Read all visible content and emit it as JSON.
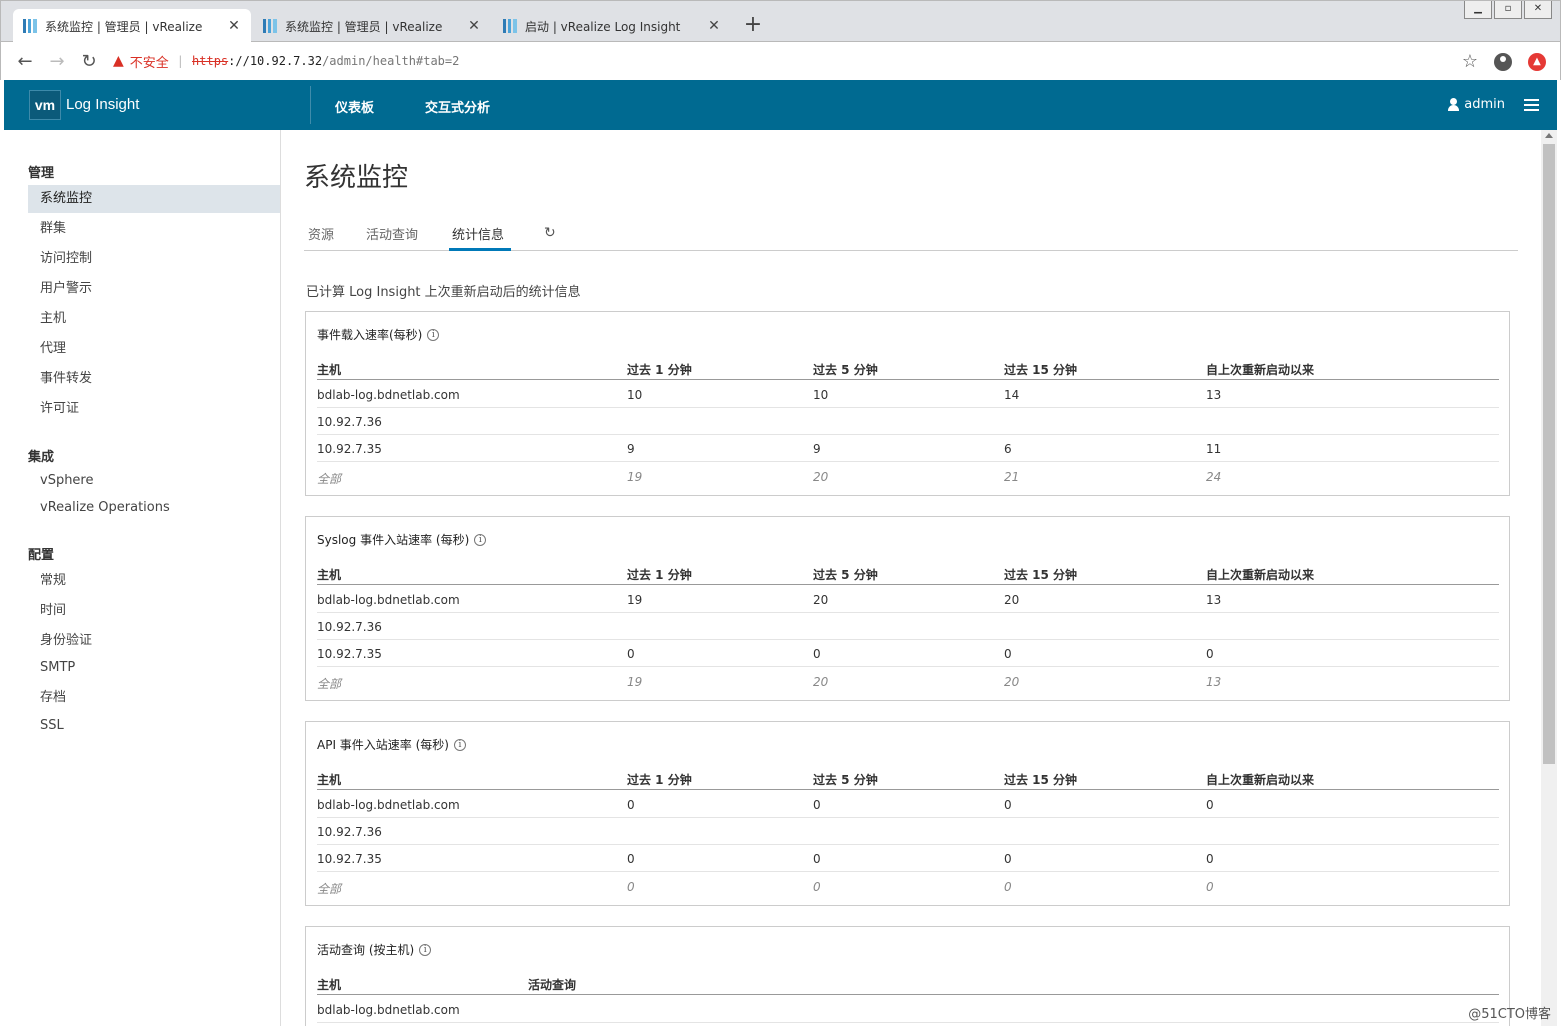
{
  "browser": {
    "tabs": [
      {
        "title": "系统监控 | 管理员 | vRealize",
        "active": true
      },
      {
        "title": "系统监控 | 管理员 | vRealize",
        "active": false
      },
      {
        "title": "启动 | vRealize Log Insight",
        "active": false
      }
    ],
    "new_tab": "+",
    "warning": "不安全",
    "url_scheme": "https",
    "url_host": "://10.92.7.32",
    "url_path": "/admin/health#tab=2"
  },
  "header": {
    "logo": "vm",
    "app_name": "Log Insight",
    "nav": [
      "仪表板",
      "交互式分析"
    ],
    "user": "admin"
  },
  "sidebar": {
    "sections": [
      {
        "heading": "管理",
        "items": [
          "系统监控",
          "群集",
          "访问控制",
          "用户警示",
          "主机",
          "代理",
          "事件转发",
          "许可证"
        ]
      },
      {
        "heading": "集成",
        "items": [
          "vSphere",
          "vRealize Operations"
        ]
      },
      {
        "heading": "配置",
        "items": [
          "常规",
          "时间",
          "身份验证",
          "SMTP",
          "存档",
          "SSL"
        ]
      }
    ],
    "active_item": "系统监控"
  },
  "page": {
    "title": "系统监控",
    "tabs": [
      "资源",
      "活动查询",
      "统计信息"
    ],
    "active_tab": "统计信息",
    "subtitle": "已计算 Log Insight 上次重新启动后的统计信息"
  },
  "columns": [
    "主机",
    "过去 1 分钟",
    "过去 5 分钟",
    "过去 15 分钟",
    "自上次重新启动以来"
  ],
  "cards": [
    {
      "title": "事件载入速率(每秒)",
      "rows": [
        [
          "bdlab-log.bdnetlab.com",
          "10",
          "10",
          "14",
          "13"
        ],
        [
          "10.92.7.36",
          "",
          "",
          "",
          ""
        ],
        [
          "10.92.7.35",
          "9",
          "9",
          "6",
          "11"
        ]
      ],
      "total": [
        "全部",
        "19",
        "20",
        "21",
        "24"
      ]
    },
    {
      "title": "Syslog 事件入站速率 (每秒)",
      "rows": [
        [
          "bdlab-log.bdnetlab.com",
          "19",
          "20",
          "20",
          "13"
        ],
        [
          "10.92.7.36",
          "",
          "",
          "",
          ""
        ],
        [
          "10.92.7.35",
          "0",
          "0",
          "0",
          "0"
        ]
      ],
      "total": [
        "全部",
        "19",
        "20",
        "20",
        "13"
      ]
    },
    {
      "title": "API 事件入站速率 (每秒)",
      "rows": [
        [
          "bdlab-log.bdnetlab.com",
          "0",
          "0",
          "0",
          "0"
        ],
        [
          "10.92.7.36",
          "",
          "",
          "",
          ""
        ],
        [
          "10.92.7.35",
          "0",
          "0",
          "0",
          "0"
        ]
      ],
      "total": [
        "全部",
        "0",
        "0",
        "0",
        "0"
      ]
    }
  ],
  "query_card": {
    "title": "活动查询 (按主机)",
    "columns": [
      "主机",
      "活动查询"
    ],
    "rows": [
      [
        "bdlab-log.bdnetlab.com",
        ""
      ]
    ]
  },
  "watermark": "@51CTO博客",
  "colors": {
    "header_bg": "#006a91",
    "accent": "#0079b8",
    "active_item_bg": "#dde4ea"
  }
}
